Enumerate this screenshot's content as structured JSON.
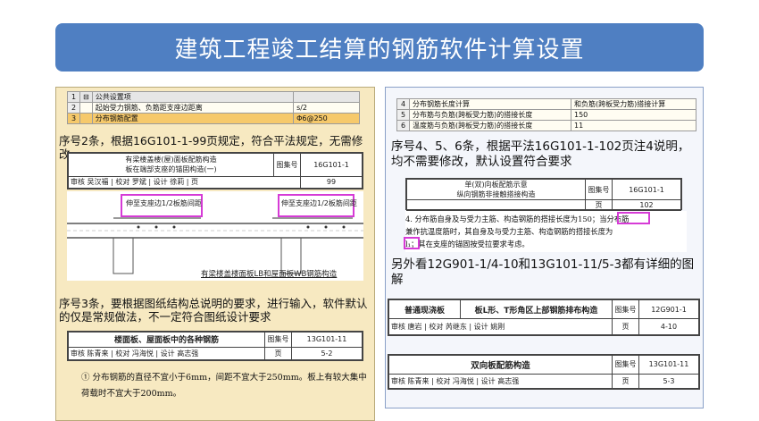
{
  "title": "建筑工程竣工结算的钢筋软件计算设置",
  "left": {
    "settings_table": {
      "rows": [
        {
          "num": "1",
          "expand": "⊟",
          "name": "公共设置项",
          "value": ""
        },
        {
          "num": "2",
          "expand": "",
          "name": "起始受力钢筋、负筋距支座边距离",
          "value": "s/2"
        },
        {
          "num": "3",
          "expand": "",
          "name": "分布钢筋配置",
          "value": "Φ6@250"
        }
      ]
    },
    "note1": "序号2条，根据16G101-1-99页规定，符合平法规定，无需修改",
    "sheet1": {
      "title_line1": "有梁楼盖楼(屋)面板配筋构造",
      "title_line2": "板在端部支座的锚固构造(一)",
      "atlas_label": "图集号",
      "atlas_no": "16G101-1",
      "review_row": "审核 吴汉福 | 校对 罗斌 | 设计 徐莉 | 页",
      "page": "99",
      "anchor_label_1": "伸至支座边1/2板筋间距",
      "anchor_label_2": "伸至支座边1/2板筋间距",
      "caption": "有梁楼盖楼面板LB和屋面板WB钢筋构造"
    },
    "note2": "序号3条，要根据图纸结构总说明的要求，进行输入，软件默认的仅是常规做法，不一定符合图纸设计要求",
    "sheet2": {
      "title": "楼面板、屋面板中的各种钢筋",
      "atlas_label": "图集号",
      "atlas_no": "13G101-11",
      "review_row": "审核 陈青来 | 校对 冯海悦 | 设计 高志强",
      "page_label": "页",
      "page": "5-2",
      "text_line1": "① 分布钢筋的直径不宜小于6mm，间距不宜大于250mm。板上有较大集中",
      "text_line2": "荷载时不宜大于200mm。"
    }
  },
  "right": {
    "settings_table": {
      "rows": [
        {
          "num": "4",
          "name": "分布钢筋长度计算",
          "value": "和负筋(跨板受力筋)搭接计算"
        },
        {
          "num": "5",
          "name": "分布筋与负筋(跨板受力筋)的搭接长度",
          "value": "150"
        },
        {
          "num": "6",
          "name": "温度筋与负筋(跨板受力筋)的搭接长度",
          "value": "11"
        }
      ]
    },
    "note1": "序号4、5、6条，根据平法16G101-1-102页注4说明，均不需要修改，默认设置符合要求",
    "sheet1": {
      "title_line1": "单(双)向板配筋示意",
      "title_line2": "纵向钢筋非接触搭接构造",
      "atlas_label": "图集号",
      "atlas_no": "16G101-1",
      "page_label": "页",
      "page": "102",
      "text_line1": "4. 分布筋自身及与受力主筋、构造钢筋的搭接长度为150；当分布筋",
      "text_line2": "兼作抗温度筋时，其自身及与受力主筋、构造钢筋的搭接长度为",
      "text_line3": "l₁；其在支座的锚固按受拉要求考虑。"
    },
    "note2": "另外看12G901-1/4-10和13G101-11/5-3都有详细的图解",
    "sheet2": {
      "title": "普通现浇板",
      "subtitle": "板L形、T形角区上部钢筋排布构造",
      "atlas_label": "图集号",
      "atlas_no": "12G901-1",
      "review_row": "审核 唐岩 | 校对 芮继东 | 设计 姚刚",
      "page_label": "页",
      "page": "4-10"
    },
    "sheet3": {
      "title": "双向板配筋构造",
      "atlas_label": "图集号",
      "atlas_no": "13G101-11",
      "review_row": "审核 陈青来 | 校对 冯海悦 | 设计 高志强",
      "page_label": "页",
      "page": "5-3"
    }
  }
}
